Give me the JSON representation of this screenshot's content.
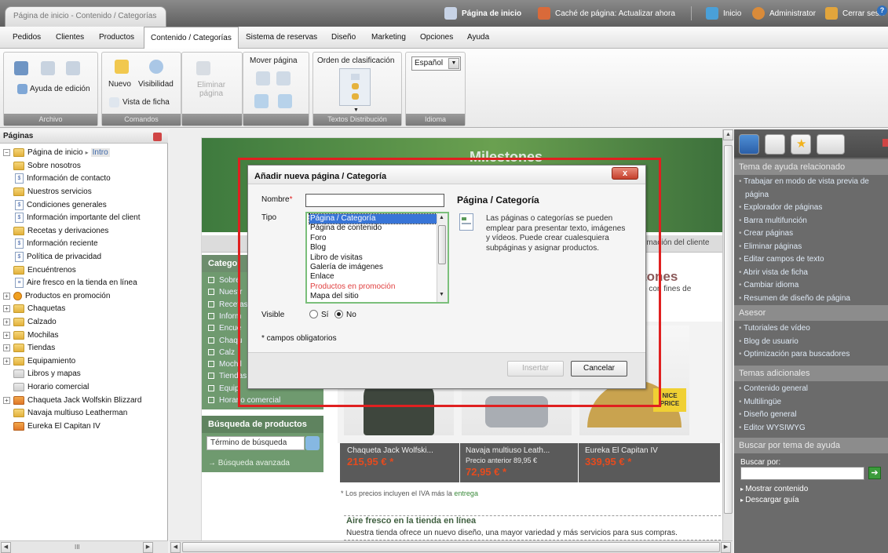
{
  "doc_tab": "Página de inicio - Contenido / Categorías",
  "topbar": {
    "home_page": "Página de inicio",
    "cache": "Caché de página: Actualizar ahora",
    "start": "Inicio",
    "user": "Administrator",
    "logout": "Cerrar sesió"
  },
  "menu": [
    "Pedidos",
    "Clientes",
    "Productos",
    "Contenido / Categorías",
    "Sistema de reservas",
    "Diseño",
    "Marketing",
    "Opciones",
    "Ayuda"
  ],
  "ribbon": {
    "archivo": {
      "help": "Ayuda de edición",
      "footer": "Archivo"
    },
    "comandos": {
      "new": "Nuevo",
      "visibility": "Visibilidad",
      "delete_l1": "Eliminar",
      "delete_l2": "página",
      "card_view": "Vista de ficha",
      "footer": "Comandos"
    },
    "move": {
      "label": "Mover página"
    },
    "sort": {
      "label": "Orden de clasificación"
    },
    "textos_footer": "Textos",
    "distribucion_footer": "Distribución",
    "idioma": {
      "value": "Español",
      "footer": "Idioma"
    }
  },
  "left_panel": {
    "title": "Páginas",
    "root": {
      "label": "Página de inicio",
      "sep": "▸",
      "sub": "Intro"
    },
    "items": [
      "Sobre nosotros",
      "Información de contacto",
      "Nuestros servicios",
      "Condiciones generales",
      "Información importante del client",
      "Recetas y derivaciones",
      "Información reciente",
      "Política de privacidad",
      "Encuéntrenos",
      "Aire fresco en la tienda en línea",
      "Productos en promoción",
      "Chaquetas",
      "Calzado",
      "Mochilas",
      "Tiendas",
      "Equipamiento",
      "Libros y mapas",
      "Horario comercial",
      "Chaqueta Jack Wolfskin Blizzard",
      "Navaja multiuso Leatherman",
      "Eureka El Capitan IV"
    ]
  },
  "preview": {
    "banner_text": "Milestones",
    "nav_right": "rmación del cliente",
    "cat_head": "Catego",
    "cat_items": [
      "Sobre",
      "Nuestr",
      "Recetas",
      "Inform",
      "Encué",
      "Chaqu",
      "Calz",
      "Mochil",
      "Tiendas",
      "Equip",
      "Horario comercial"
    ],
    "side_fragment": "tones",
    "side_fragment2": "o con fines de",
    "search_head": "Búsqueda de productos",
    "search_placeholder": "Término de búsqueda",
    "adv_search": "→ Búsqueda avanzada",
    "products": [
      {
        "name": "Chaqueta Jack Wolfski...",
        "price": "215,95 € *",
        "old": ""
      },
      {
        "name": "Navaja multiuso Leath...",
        "old": "Precio anterior 89,95 €",
        "price": "72,95 € *"
      },
      {
        "name": "Eureka El Capitan IV",
        "price": "339,95 € *",
        "old": ""
      }
    ],
    "nice_price": "NICE PRICE",
    "iva_note": "* Los precios incluyen el IVA más la",
    "iva_link": "entrega",
    "fresh_title": "Aire fresco en la tienda en línea",
    "fresh_desc": "Nuestra tienda ofrece un nuevo diseño, una mayor variedad y más servicios para sus compras."
  },
  "right_panel": {
    "section_help": "Tema de ayuda relacionado",
    "help_links": [
      "Trabajar en modo de vista previa de",
      "página",
      "Explorador de páginas",
      "Barra multifunción",
      "Crear páginas",
      "Eliminar páginas",
      "Editar campos de texto",
      "Abrir vista de ficha",
      "Cambiar idioma",
      "Resumen de diseño de página"
    ],
    "section_asesor": "Asesor",
    "asesor_links": [
      "Tutoriales de vídeo",
      "Blog de usuario",
      "Optimización para buscadores"
    ],
    "section_temas": "Temas adicionales",
    "temas_links": [
      "Contenido general",
      "Multilingüe",
      "Diseño general",
      "Editor WYSIWYG"
    ],
    "section_buscar": "Buscar por tema de ayuda",
    "buscar_label": "Buscar por:",
    "bottom_links": [
      "Mostrar contenido",
      "Descargar guía"
    ]
  },
  "dialog": {
    "title": "Añadir nueva página / Categoría",
    "close": "x",
    "nombre_label": "Nombre",
    "required_mark": "*",
    "tipo_label": "Tipo",
    "tipo_options": [
      "Página / Categoría",
      "Página de contenido",
      "Foro",
      "Blog",
      "Libro de visitas",
      "Galería de imágenes",
      "Enlace",
      "Productos en promoción",
      "Mapa del sitio"
    ],
    "selected_index": 0,
    "desc_title": "Página / Categoría",
    "desc_text": "Las páginas o categorías se pueden emplear para presentar texto, imágenes y vídeos. Puede crear cualesquiera subpáginas y asignar productos.",
    "visible_label": "Visible",
    "visible_yes": "Sí",
    "visible_no": "No",
    "visible_value": "No",
    "required_note": "* campos obligatorios",
    "insert": "Insertar",
    "cancel": "Cancelar"
  }
}
